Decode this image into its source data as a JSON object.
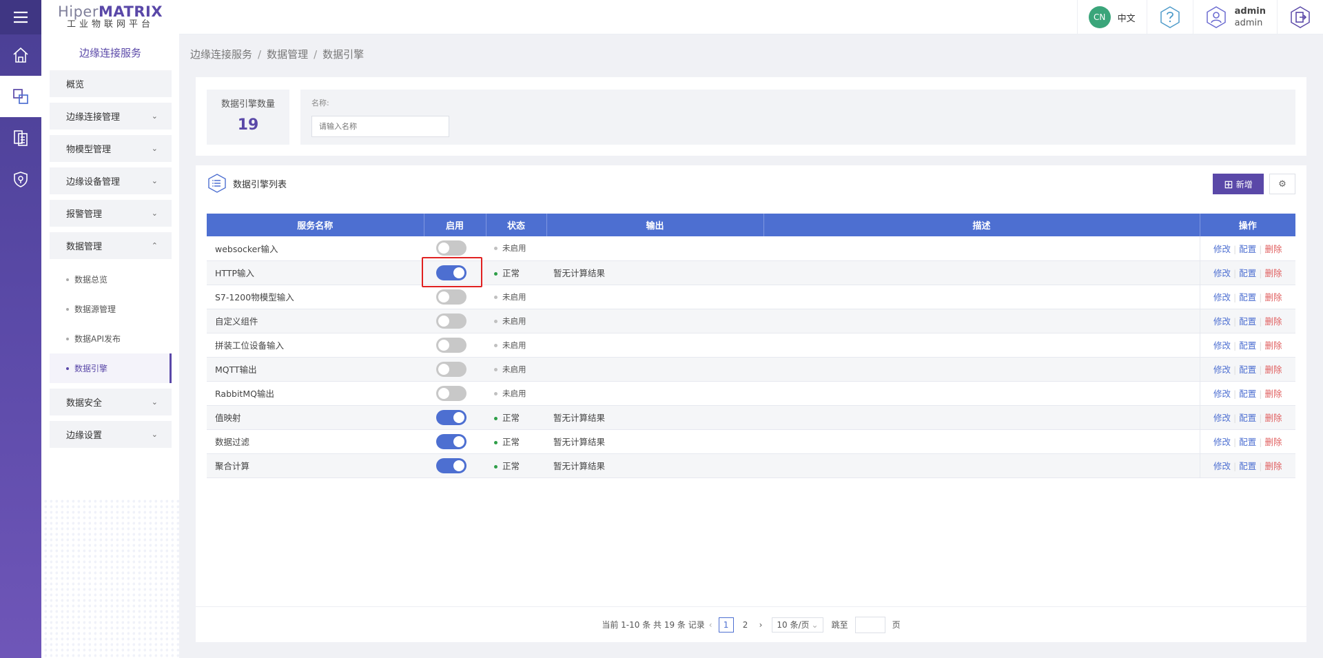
{
  "logo": {
    "brand_a": "Hiper",
    "brand_b": "MATRIX",
    "subtitle": "工业物联网平台"
  },
  "topbar": {
    "lang_badge": "CN",
    "lang_label": "中文",
    "user_name": "admin",
    "user_role": "admin"
  },
  "sidebar": {
    "title": "边缘连接服务",
    "items": [
      {
        "label": "概览"
      },
      {
        "label": "边缘连接管理"
      },
      {
        "label": "物模型管理"
      },
      {
        "label": "边缘设备管理"
      },
      {
        "label": "报警管理"
      },
      {
        "label": "数据管理"
      },
      {
        "label": "数据安全"
      },
      {
        "label": "边缘设置"
      }
    ],
    "sub_items": [
      {
        "label": "数据总览"
      },
      {
        "label": "数据源管理"
      },
      {
        "label": "数据API发布"
      },
      {
        "label": "数据引擎"
      }
    ]
  },
  "breadcrumb": {
    "l1": "边缘连接服务",
    "l2": "数据管理",
    "l3": "数据引擎",
    "sep": "/"
  },
  "stats": {
    "label": "数据引擎数量",
    "value": "19"
  },
  "filter": {
    "label": "名称:",
    "placeholder": "请输入名称"
  },
  "list": {
    "title": "数据引擎列表",
    "add_label": "新增",
    "gear": "⚙"
  },
  "table": {
    "headers": [
      "服务名称",
      "启用",
      "状态",
      "输出",
      "描述",
      "操作"
    ],
    "ops": {
      "edit": "修改",
      "config": "配置",
      "delete": "删除"
    },
    "rows": [
      {
        "name": "websocker输入",
        "enabled": false,
        "status": "未启用",
        "output": ""
      },
      {
        "name": "HTTP输入",
        "enabled": true,
        "status": "正常",
        "output": "暂无计算结果"
      },
      {
        "name": "S7-1200物模型输入",
        "enabled": false,
        "status": "未启用",
        "output": ""
      },
      {
        "name": "自定义组件",
        "enabled": false,
        "status": "未启用",
        "output": ""
      },
      {
        "name": "拼装工位设备输入",
        "enabled": false,
        "status": "未启用",
        "output": ""
      },
      {
        "name": "MQTT输出",
        "enabled": false,
        "status": "未启用",
        "output": ""
      },
      {
        "name": "RabbitMQ输出",
        "enabled": false,
        "status": "未启用",
        "output": ""
      },
      {
        "name": "值映射",
        "enabled": true,
        "status": "正常",
        "output": "暂无计算结果"
      },
      {
        "name": "数据过滤",
        "enabled": true,
        "status": "正常",
        "output": "暂无计算结果"
      },
      {
        "name": "聚合计算",
        "enabled": true,
        "status": "正常",
        "output": "暂无计算结果"
      }
    ]
  },
  "pager": {
    "summary": "当前 1-10 条 共 19 条 记录",
    "page1": "1",
    "page2": "2",
    "size": "10 条/页",
    "jump_label": "跳至",
    "page_unit": "页"
  }
}
